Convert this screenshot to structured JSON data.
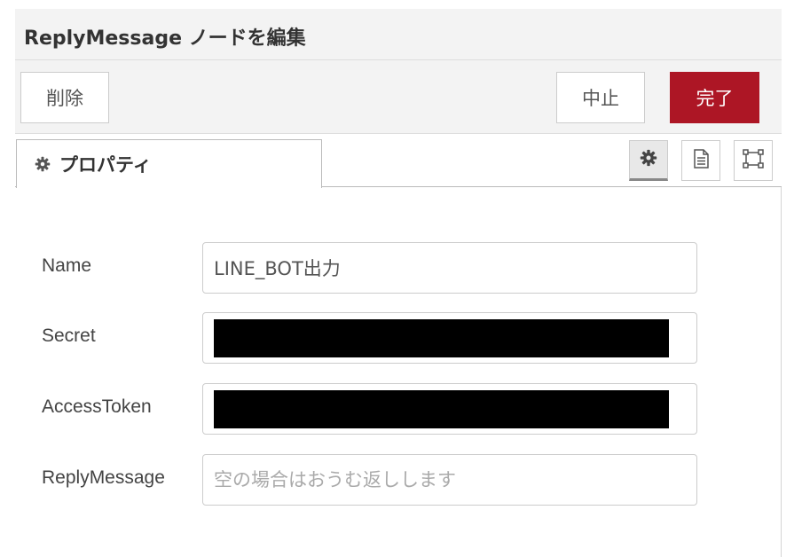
{
  "dialog": {
    "title": "ReplyMessage ノードを編集"
  },
  "toolbar": {
    "delete_label": "削除",
    "cancel_label": "中止",
    "done_label": "完了",
    "done_color": "#ad1625"
  },
  "tabs": {
    "properties_label": "プロパティ",
    "properties_icon": "gear-icon",
    "buttons": [
      {
        "icon": "gear-icon"
      },
      {
        "icon": "document-icon"
      },
      {
        "icon": "frame-icon"
      }
    ]
  },
  "form": {
    "name": {
      "label": "Name",
      "value": "LINE_BOT出力"
    },
    "secret": {
      "label": "Secret",
      "value": ""
    },
    "access_token": {
      "label": "AccessToken",
      "value": ""
    },
    "reply_message": {
      "label": "ReplyMessage",
      "value": "",
      "placeholder": "空の場合はおうむ返しします"
    }
  }
}
